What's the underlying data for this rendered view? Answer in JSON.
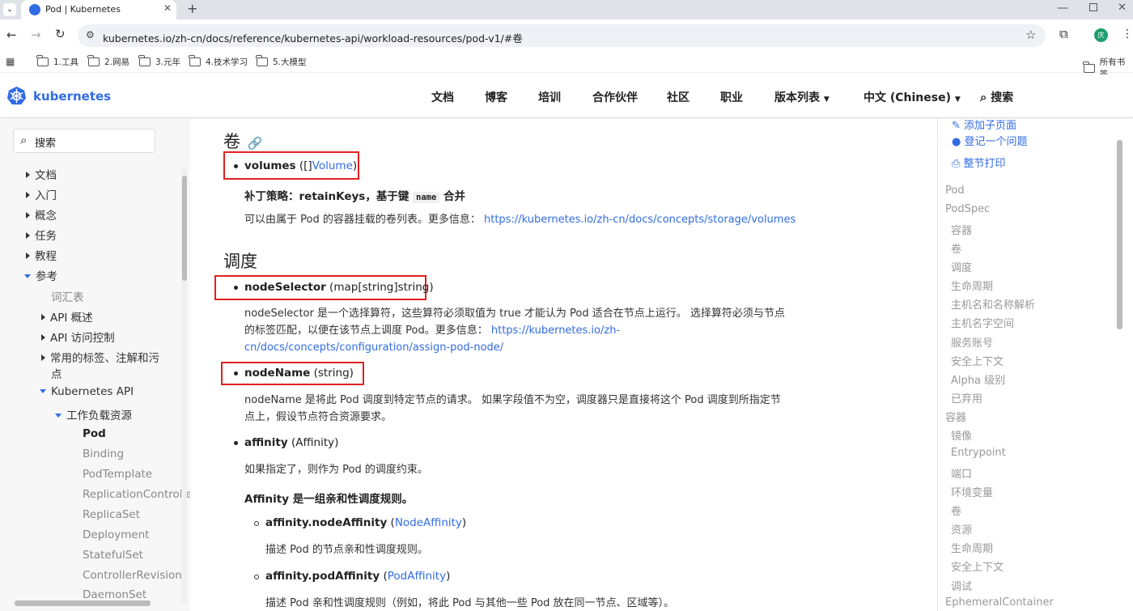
{
  "browser": {
    "tab_title": "Pod | Kubernetes",
    "url": "kubernetes.io/zh-cn/docs/reference/kubernetes-api/workload-resources/pod-v1/#卷",
    "profile_initial": "庆",
    "bookmarks": [
      "1.工具",
      "2.网易",
      "3.元年",
      "4.技术学习",
      "5.大模型"
    ],
    "all_bookmarks": "所有书签"
  },
  "site": {
    "brand": "kubernetes",
    "nav": [
      "文档",
      "博客",
      "培训",
      "合作伙伴",
      "社区",
      "职业",
      "版本列表",
      "中文 (Chinese)"
    ],
    "search": "搜索"
  },
  "sidebar": {
    "search_placeholder": "搜索",
    "items": [
      "文档",
      "入门",
      "概念",
      "任务",
      "教程",
      "参考",
      "词汇表",
      "API 概述",
      "API 访问控制",
      "常用的标签、注解和污",
      "点",
      "Kubernetes API",
      "工作负载资源",
      "Pod",
      "Binding",
      "PodTemplate",
      "ReplicationControlle",
      "ReplicaSet",
      "Deployment",
      "StatefulSet",
      "ControllerRevision",
      "DaemonSet"
    ]
  },
  "main": {
    "sec_volumes": "卷",
    "volumes_name": "volumes",
    "volumes_type_pre": " ([]",
    "volumes_type_link": "Volume",
    "volumes_type_post": ")",
    "patch_pre": "补丁策略：retainKeys，基于键 ",
    "patch_code": "name",
    "patch_post": " 合并",
    "volumes_desc": "可以由属于 Pod 的容器挂载的卷列表。更多信息：",
    "volumes_link": "https://kubernetes.io/zh-cn/docs/concepts/storage/volumes",
    "sec_scheduling": "调度",
    "nodesel_name": "nodeSelector",
    "nodesel_type": " (map[string]string)",
    "nodesel_desc1": "nodeSelector 是一个选择算符，这些算符必须取值为 true 才能认为 Pod 适合在节点上运行。 选择算符必须与节点",
    "nodesel_desc2": "的标签匹配，以便在该节点上调度 Pod。更多信息：",
    "nodesel_link1": "https://kubernetes.io/zh-",
    "nodesel_link2": "cn/docs/concepts/configuration/assign-pod-node/",
    "nodename_name": "nodeName",
    "nodename_type": " (string)",
    "nodename_desc1": "nodeName 是将此 Pod 调度到特定节点的请求。 如果字段值不为空，调度器只是直接将这个 Pod 调度到所指定节",
    "nodename_desc2": "点上，假设节点符合资源要求。",
    "affinity_name": "affinity",
    "affinity_type": " (Affinity)",
    "affinity_desc": "如果指定了，则作为 Pod 的调度约束。",
    "affinity_bold": "Affinity 是一组亲和性调度规则。",
    "na_name": "affinity.nodeAffinity",
    "na_pre": " (",
    "na_link": "NodeAffinity",
    "na_post": ")",
    "na_desc": "描述 Pod 的节点亲和性调度规则。",
    "pa_name": "affinity.podAffinity",
    "pa_pre": " (",
    "pa_link": "PodAffinity",
    "pa_post": ")",
    "pa_desc": "描述 Pod 亲和性调度规则（例如，将此 Pod 与其他一些 Pod 放在同一节点、区域等）。"
  },
  "toc": {
    "actions": [
      "添加子页面",
      "登记一个问题",
      "整节打印"
    ],
    "items": [
      "Pod",
      "PodSpec",
      "容器",
      "卷",
      "调度",
      "生命周期",
      "主机名和名称解析",
      "主机名字空间",
      "服务账号",
      "安全上下文",
      "Alpha 级别",
      "已弃用",
      "容器",
      "镜像",
      "Entrypoint",
      "端口",
      "环境变量",
      "卷",
      "资源",
      "生命周期",
      "安全上下文",
      "调试",
      "EphemeralContainer"
    ]
  }
}
